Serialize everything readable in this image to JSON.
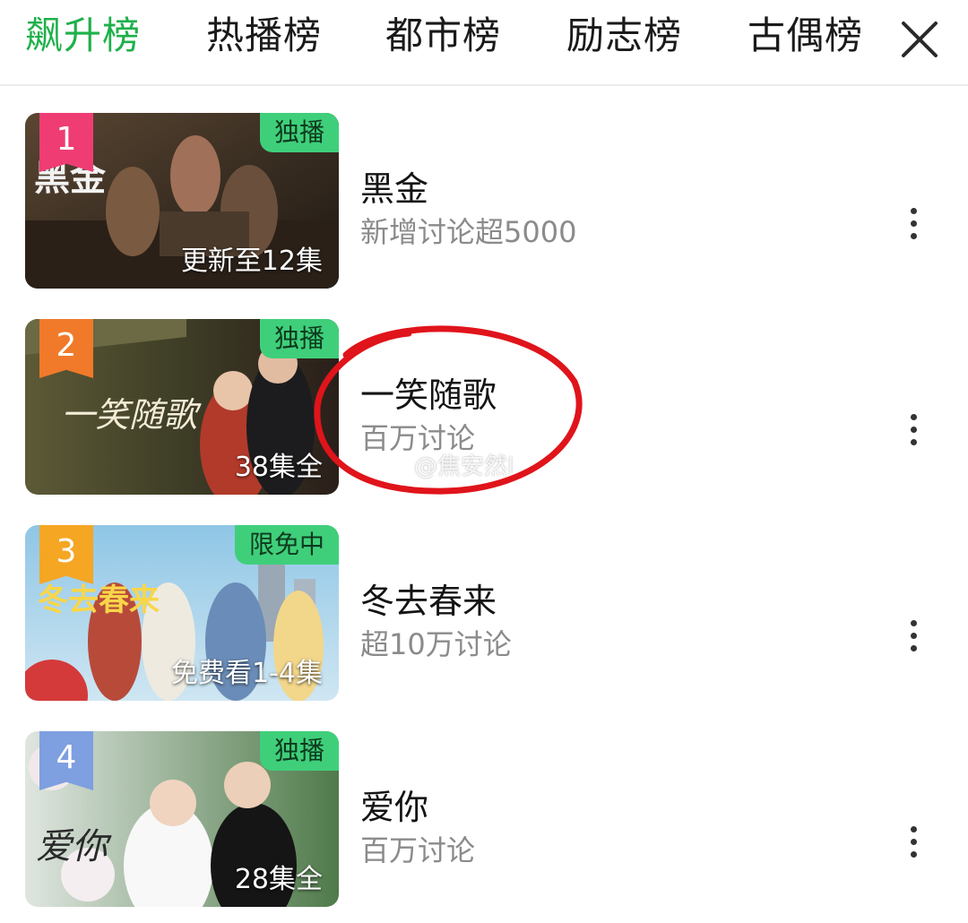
{
  "tabs": [
    {
      "label": "飙升榜",
      "active": true
    },
    {
      "label": "热播榜",
      "active": false
    },
    {
      "label": "都市榜",
      "active": false
    },
    {
      "label": "励志榜",
      "active": false
    },
    {
      "label": "古偶榜",
      "active": false
    }
  ],
  "colors": {
    "accent": "#1fb04a",
    "circle": "#e0141b"
  },
  "items": [
    {
      "rank": "1",
      "badge": "独播",
      "status": "更新至12集",
      "title": "黑金",
      "subtitle": "新增讨论超5000",
      "rank_color": "#ef3d74",
      "poster_text": "黑金"
    },
    {
      "rank": "2",
      "badge": "独播",
      "status": "38集全",
      "title": "一笑随歌",
      "subtitle": "百万讨论",
      "rank_color": "#f07a2a",
      "poster_text": "一笑随歌"
    },
    {
      "rank": "3",
      "badge": "限免中",
      "status": "免费看1-4集",
      "title": "冬去春来",
      "subtitle": "超10万讨论",
      "rank_color": "#f5a623",
      "poster_text": "冬去春来"
    },
    {
      "rank": "4",
      "badge": "独播",
      "status": "28集全",
      "title": "爱你",
      "subtitle": "百万讨论",
      "rank_color": "#7e9fe0",
      "poster_text": "爱你"
    }
  ],
  "watermark": "@焦安然l",
  "icons": {
    "close": "close-icon",
    "more": "more-vertical-icon"
  }
}
